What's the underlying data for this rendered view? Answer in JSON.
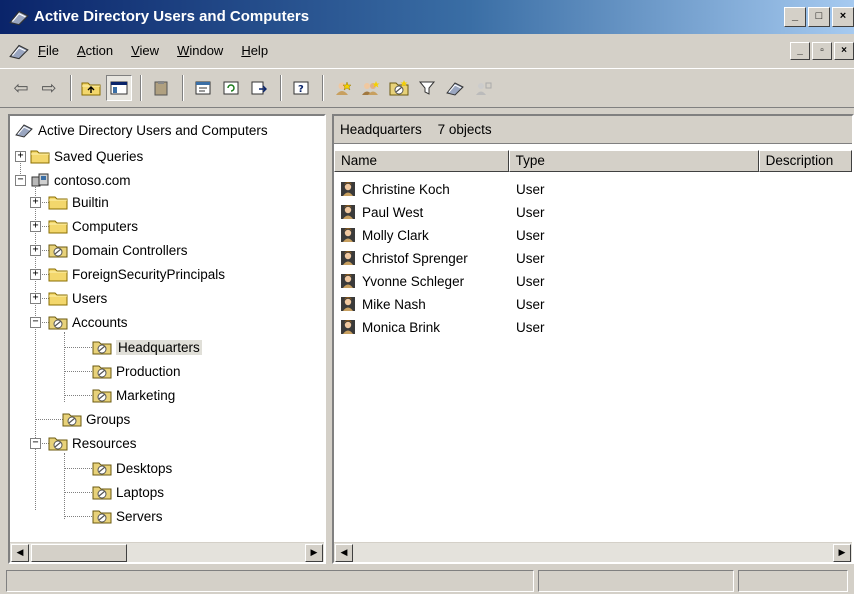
{
  "window": {
    "title": "Active Directory Users and Computers",
    "btn_min": "_",
    "btn_max": "□",
    "btn_close": "×"
  },
  "menu": {
    "items": [
      {
        "label": "File",
        "u": "F",
        "rest": "ile"
      },
      {
        "label": "Action",
        "u": "A",
        "rest": "ction"
      },
      {
        "label": "View",
        "u": "V",
        "rest": "iew"
      },
      {
        "label": "Window",
        "u": "W",
        "rest": "indow"
      },
      {
        "label": "Help",
        "u": "H",
        "rest": "elp"
      }
    ],
    "child_min": "_",
    "child_restore": "▫",
    "child_close": "×"
  },
  "toolbar": {
    "back": "⇦",
    "forward": "⇨"
  },
  "tree": {
    "root": "Active Directory Users and Computers",
    "saved_queries": "Saved Queries",
    "domain": "contoso.com",
    "builtin": "Builtin",
    "computers": "Computers",
    "domain_controllers": "Domain Controllers",
    "foreign_security_principals": "ForeignSecurityPrincipals",
    "users": "Users",
    "accounts": "Accounts",
    "headquarters": "Headquarters",
    "production": "Production",
    "marketing": "Marketing",
    "groups": "Groups",
    "resources": "Resources",
    "desktops": "Desktops",
    "laptops": "Laptops",
    "servers": "Servers",
    "expand_sym": "+",
    "collapse_sym": "−"
  },
  "details": {
    "location": "Headquarters",
    "object_count": "7 objects",
    "columns": {
      "name": "Name",
      "type": "Type",
      "description": "Description"
    },
    "rows": [
      {
        "name": "Christine Koch",
        "type": "User"
      },
      {
        "name": "Paul West",
        "type": "User"
      },
      {
        "name": "Molly Clark",
        "type": "User"
      },
      {
        "name": "Christof Sprenger",
        "type": "User"
      },
      {
        "name": "Yvonne Schleger",
        "type": "User"
      },
      {
        "name": "Mike Nash",
        "type": "User"
      },
      {
        "name": "Monica Brink",
        "type": "User"
      }
    ]
  },
  "scroll": {
    "left_arrow": "◀",
    "right_arrow": "▶"
  },
  "colors": {
    "title_start": "#0a246a",
    "title_end": "#a6caf0",
    "folder": "#f3d76c",
    "ou_icon": "#d9c25a"
  }
}
